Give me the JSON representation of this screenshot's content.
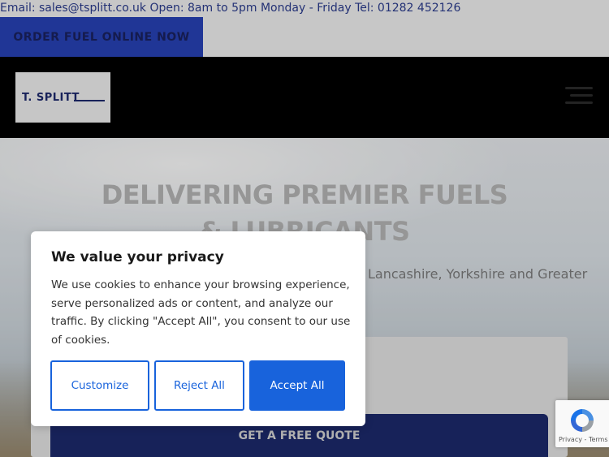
{
  "topbar": {
    "info_text": "Email: sales@tsplitt.co.uk  Open: 8am to 5pm Monday - Friday  Tel: 01282 452126",
    "order_button": "ORDER FUEL ONLINE NOW"
  },
  "header": {
    "logo_text": "T. SPLITT"
  },
  "hero": {
    "title": "DELIVERING PREMIER FUELS & LUBRICANTS",
    "subtitle": "Lancashire, Yorkshire and Greater"
  },
  "quote": {
    "button": "GET A FREE QUOTE"
  },
  "cookie": {
    "title": "We value your privacy",
    "body": "We use cookies to enhance your browsing experience, serve personalized ads or content, and analyze our traffic. By clicking \"Accept All\", you consent to our use of cookies.",
    "customize": "Customize",
    "reject": "Reject All",
    "accept": "Accept All"
  },
  "recaptcha": {
    "links": "Privacy - Terms"
  },
  "colors": {
    "brand_blue": "#1863dc",
    "navy": "#1d2a6d"
  }
}
